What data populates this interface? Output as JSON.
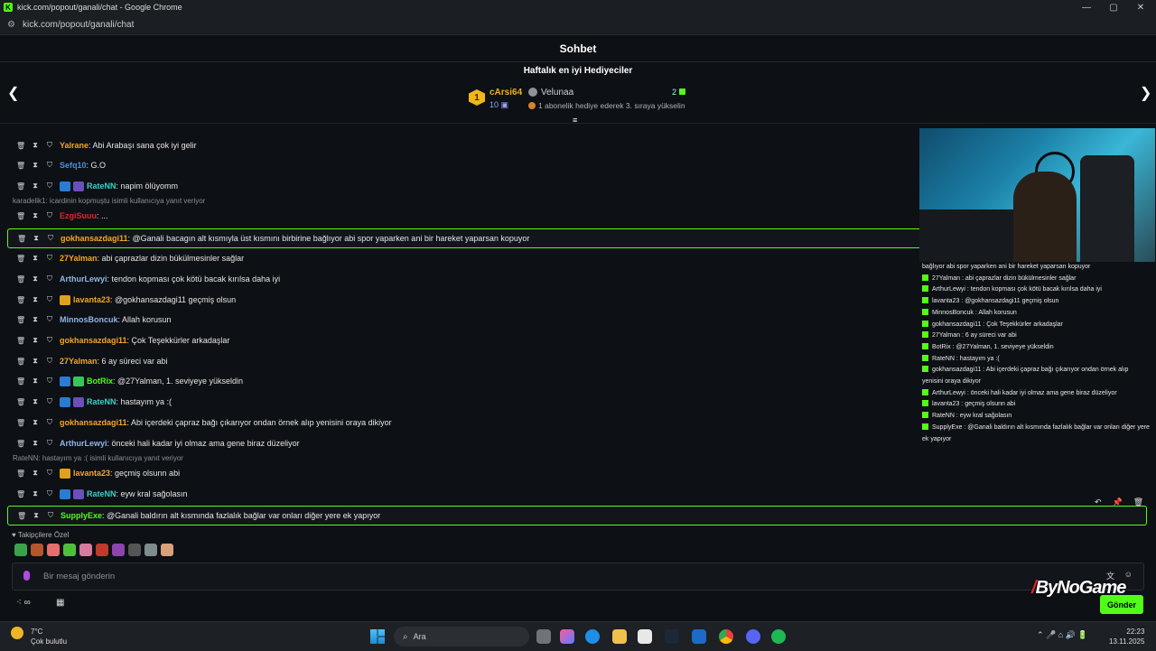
{
  "window": {
    "title": "kick.com/popout/ganali/chat - Google Chrome",
    "url": "kick.com/popout/ganali/chat"
  },
  "header": {
    "title": "Sohbet"
  },
  "gifters": {
    "title": "Haftalık en iyi Hediyeciler",
    "first": {
      "rank": "1",
      "name": "cArsi64",
      "count": "10"
    },
    "second": {
      "name": "Velunaa",
      "count": "2",
      "hint": "1 abonelik hediye ederek 3. sıraya yükselin"
    }
  },
  "messages": [
    {
      "user": "Yalrane",
      "text": ": Abi Arabaşı sana çok iyi gelir",
      "color": "#f5a623",
      "badges": []
    },
    {
      "user": "Sefq10",
      "text": ": G.O",
      "color": "#4a90e2",
      "badges": []
    },
    {
      "user": "RateNN",
      "text": ": napim ölüyomm",
      "color": "#39d0c8",
      "badges": [
        "#2a7bd3",
        "#6b4fbb"
      ]
    },
    {
      "user": "EzgiSuuu",
      "text": ": ...",
      "color": "#e0262b",
      "badges": [],
      "reply": "karadelik1: icardinin kopmuştu isimli kullanıcıya yanıt veriyor"
    },
    {
      "user": "gokhansazdagi11",
      "text": ": @Ganali bacagın alt kısmıyla üst kısmını birbirine bağlıyor abi spor yaparken ani bir hareket yaparsan kopuyor",
      "color": "#f5a623",
      "badges": [],
      "highlight": true
    },
    {
      "user": "27Yalman",
      "text": ": abi çaprazlar dizin bükülmesinler sağlar",
      "color": "#f5a623",
      "badges": []
    },
    {
      "user": "ArthurLewyi",
      "text": ": tendon kopması çok kötü bacak kırılsa daha iyi",
      "color": "#8fb6e8",
      "badges": []
    },
    {
      "user": "lavanta23",
      "text": ": @gokhansazdagi11 geçmiş olsun",
      "color": "#f5a623",
      "badges": [
        "#e0a21b"
      ]
    },
    {
      "user": "MinnosBoncuk",
      "text": ": Allah korusun",
      "color": "#8fb6e8",
      "badges": []
    },
    {
      "user": "gokhansazdagi11",
      "text": ": Çok Teşekkürler arkadaşlar",
      "color": "#f5a623",
      "badges": []
    },
    {
      "user": "27Yalman",
      "text": ": 6 ay süreci var abi",
      "color": "#f5a623",
      "badges": []
    },
    {
      "user": "BotRix",
      "text": ": @27Yalman, 1. seviyeye yükseldin",
      "color": "#53fc18",
      "badges": [
        "#2a7bd3",
        "#35c759"
      ]
    },
    {
      "user": "RateNN",
      "text": ": hastayım ya :(",
      "color": "#39d0c8",
      "badges": [
        "#2a7bd3",
        "#6b4fbb"
      ]
    },
    {
      "user": "gokhansazdagi11",
      "text": ": Abi içerdeki çapraz bağı çıkarıyor ondan örnek alıp yenisini oraya dikiyor",
      "color": "#f5a623",
      "badges": []
    },
    {
      "user": "ArthurLewyi",
      "text": ": önceki hali kadar iyi olmaz ama gene biraz düzeliyor",
      "color": "#8fb6e8",
      "badges": []
    },
    {
      "user": "lavanta23",
      "text": ": geçmiş olsunn abi",
      "color": "#f5a623",
      "badges": [
        "#e0a21b"
      ],
      "reply": "RateNN: hastayım ya :( isimli kullanıcıya yanıt veriyor"
    },
    {
      "user": "RateNN",
      "text": ": eyw kral sağolasın",
      "color": "#39d0c8",
      "badges": [
        "#2a7bd3",
        "#6b4fbb"
      ]
    },
    {
      "user": "SupplyExe",
      "text": ": @Ganali baldırın alt kısmında fazlalık bağlar var onları diğer yere ek yapıyor",
      "color": "#53fc18",
      "badges": [],
      "highlight": true
    }
  ],
  "overlay": [
    {
      "t": "bağlıyor abi spor yaparken ani bir hareket yaparsan kopuyor",
      "noBadge": true
    },
    {
      "t": "27Yalman : abi çaprazlar dizin bükülmesinler sağlar"
    },
    {
      "t": "ArthurLewyi : tendon kopması çok kötü bacak kırılsa daha iyi"
    },
    {
      "t": "lavanta23 : @gokhansazdagi11 geçmiş olsun"
    },
    {
      "t": "MinnosBoncuk : Allah korusun"
    },
    {
      "t": "gokhansazdagi11 : Çok Teşekkürler arkadaşlar"
    },
    {
      "t": "27Yalman : 6 ay süreci var abi"
    },
    {
      "t": "BotRix : @27Yalman, 1. seviyeye yükseldin"
    },
    {
      "t": "RateNN : hastayım ya :("
    },
    {
      "t": "gokhansazdagi11 : Abi içerdeki çapraz bağı çıkarıyor ondan örnek alıp"
    },
    {
      "t": "yenisini oraya dikiyor",
      "noBadge": true
    },
    {
      "t": "ArthurLewyi : önceki hali kadar iyi olmaz ama gene biraz düzeliyor"
    },
    {
      "t": "lavanta23 : geçmiş olsunn abi"
    },
    {
      "t": "RateNN : eyw kral sağolasın"
    },
    {
      "t": "SupplyExe : @Ganali baldırın alt kısmında fazlalık bağlar var onları diğer yere"
    },
    {
      "t": "ek yapıyor",
      "noBadge": true
    }
  ],
  "followers": {
    "label": "Takipçilere Özel"
  },
  "emotes": [
    "#3aa34a",
    "#b5552b",
    "#e86d6d",
    "#4fbf3a",
    "#d67aa0",
    "#c0392b",
    "#8e44ad",
    "#555555",
    "#7f8c8d",
    "#d9a07a"
  ],
  "input": {
    "placeholder": "Bir mesaj gönderin"
  },
  "send_label": "Gönder",
  "watermark": {
    "left": "ByNo",
    "right": "Game"
  },
  "taskbar": {
    "temp": "7°C",
    "weather": "Çok bulutlu",
    "search": "Ara",
    "time": "22:23",
    "date": "13.11.2025"
  },
  "colors": {
    "accent": "#53fc18",
    "background": "#0d1014"
  }
}
